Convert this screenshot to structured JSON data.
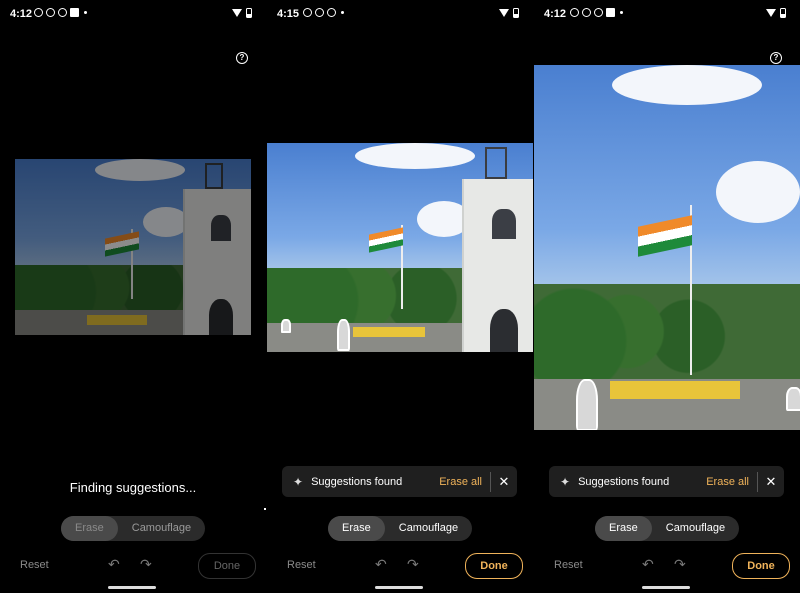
{
  "screens": [
    {
      "time": "4:12",
      "status_text": "",
      "erase_label": "Erase",
      "camouflage_label": "Camouflage",
      "reset_label": "Reset",
      "done_label": "Done",
      "done_enabled": false,
      "selected_tool": "Erase"
    },
    {
      "time": "4:15",
      "snackbar_message": "Suggestions found",
      "snackbar_action": "Erase all",
      "erase_label": "Erase",
      "camouflage_label": "Camouflage",
      "reset_label": "Reset",
      "done_label": "Done",
      "done_enabled": true,
      "selected_tool": "Erase"
    },
    {
      "time": "4:12",
      "snackbar_message": "Suggestions found",
      "snackbar_action": "Erase all",
      "erase_label": "Erase",
      "camouflage_label": "Camouflage",
      "reset_label": "Reset",
      "done_label": "Done",
      "done_enabled": true,
      "selected_tool": "Erase"
    }
  ],
  "finding_text": "Finding suggestions...",
  "icons": {
    "help": "help-circle-icon",
    "undo": "undo-icon",
    "redo": "redo-icon",
    "close": "close-icon",
    "sparkle": "sparkle-icon"
  },
  "colors": {
    "accent": "#f0b35a",
    "background": "#000000",
    "snackbar": "#1f1f1f",
    "segment_bg": "#2b2b2b",
    "segment_selected": "#4a4a4a"
  }
}
